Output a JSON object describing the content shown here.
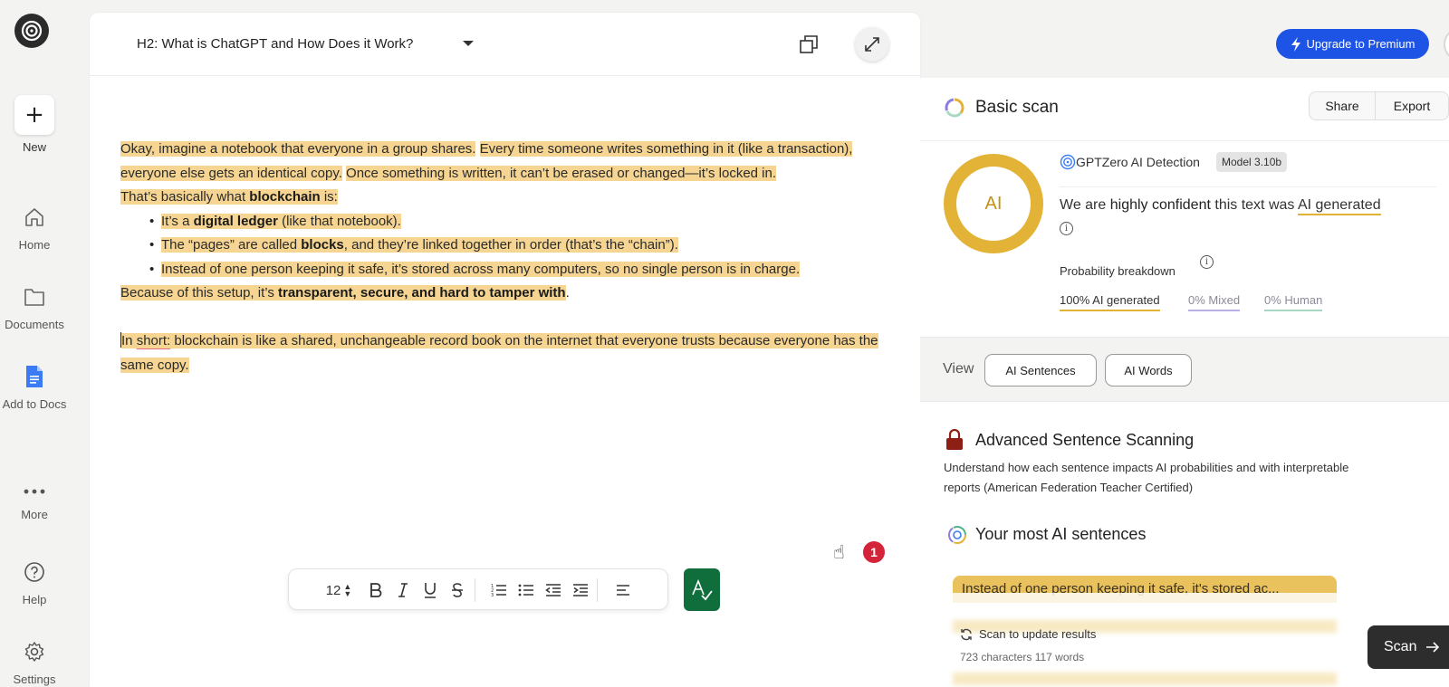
{
  "nav": {
    "new_label": "New",
    "items": [
      {
        "label": "Home",
        "icon": "home-icon"
      },
      {
        "label": "Documents",
        "icon": "folder-icon"
      },
      {
        "label": "Add to Docs",
        "icon": "google-docs-icon"
      },
      {
        "label": "More",
        "icon": "more-icon"
      },
      {
        "label": "Help",
        "icon": "help-icon"
      },
      {
        "label": "Settings",
        "icon": "settings-icon"
      }
    ]
  },
  "editor": {
    "title": "H2: What is ChatGPT and How Does it Work?",
    "paragraph1": {
      "s1": "Okay, imagine a notebook that everyone in a group shares.",
      "s2": "Every time someone writes something in it (like a transaction), everyone else gets an identical copy.",
      "s3": "Once something is written, it can’t be erased or changed—it’s locked in."
    },
    "line2": {
      "pre": "That’s basically what ",
      "bold": "blockchain",
      "post": " is:"
    },
    "bullets": [
      {
        "pre": "It’s a ",
        "bold": "digital ledger",
        "post": " (like that notebook)."
      },
      {
        "pre": "The “pages” are called ",
        "bold": "blocks",
        "post": ", and they’re linked together in order (that’s the “chain”)."
      },
      {
        "pre": "Instead of one person keeping it safe, it’s stored across many computers, so no single person is in charge.",
        "bold": "",
        "post": ""
      }
    ],
    "line3": {
      "pre": "Because of this setup, it’s ",
      "bold": "transparent, secure, and hard to tamper with",
      "post": "."
    },
    "summary": {
      "first": "In ",
      "flagged": "short:",
      "rest": " blockchain is like a shared, unchangeable record book on the internet that everyone trusts because everyone has the same copy."
    },
    "font_size": "12",
    "notification_count": "1"
  },
  "header": {
    "upgrade_label": "Upgrade to Premium"
  },
  "scan": {
    "title": "Basic scan",
    "share_label": "Share",
    "export_label": "Export",
    "badge_text": "AI",
    "detector_label": "GPTZero AI Detection",
    "model": "Model 3.10b",
    "confidence_pre": "We are ",
    "confidence_strong": "highly confident",
    "confidence_mid": " this text was ",
    "confidence_result": "AI generated",
    "probability_label": "Probability breakdown",
    "breakdown": {
      "ai": "100% AI generated",
      "mixed": "0% Mixed",
      "human": "0% Human"
    },
    "view_label": "View",
    "view_sentences": "AI Sentences",
    "view_words": "AI Words",
    "advanced_title": "Advanced Sentence Scanning",
    "advanced_desc": "Understand how each sentence impacts AI probabilities and with interpretable reports (American Federation Teacher Certified)",
    "most_title": "Your most AI sentences",
    "top_sentence": "Instead of one person keeping it safe, it's stored ac...",
    "update_label": "Scan to update results",
    "counts": "723 characters 117 words",
    "scan_button": "Scan"
  },
  "colors": {
    "highlight": "#f6d592",
    "ai": "#e2b336",
    "upgrade": "#1e54e6",
    "grammar": "#0f6e3c",
    "mixed": "#b9b1e6",
    "human": "#a8d8c4"
  }
}
